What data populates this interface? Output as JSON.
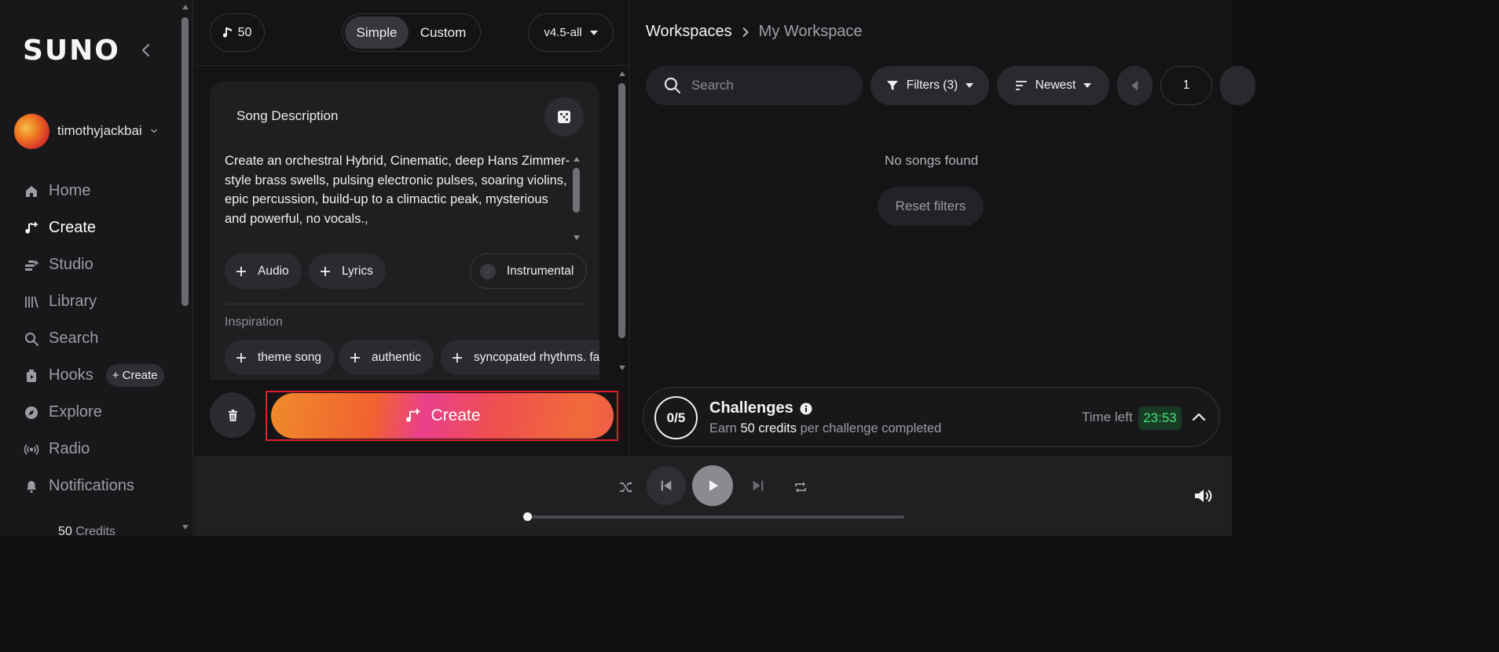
{
  "sidebar": {
    "logo": "SUNO",
    "username": "timothyjackbai",
    "nav": [
      {
        "label": "Home",
        "icon": "home-icon",
        "active": false
      },
      {
        "label": "Create",
        "icon": "music-note-plus-icon",
        "active": true
      },
      {
        "label": "Studio",
        "icon": "studio-icon",
        "active": false
      },
      {
        "label": "Library",
        "icon": "library-icon",
        "active": false
      },
      {
        "label": "Search",
        "icon": "search-icon",
        "active": false
      },
      {
        "label": "Hooks",
        "icon": "hooks-icon",
        "active": false
      },
      {
        "label": "Explore",
        "icon": "compass-icon",
        "active": false
      },
      {
        "label": "Radio",
        "icon": "radio-icon",
        "active": false
      },
      {
        "label": "Notifications",
        "icon": "bell-icon",
        "active": false
      }
    ],
    "hooks_create_label": "+ Create",
    "credits_value": "50",
    "credits_label": " Credits"
  },
  "create_panel": {
    "credits_count": "50",
    "mode_options": [
      "Simple",
      "Custom"
    ],
    "mode_selected": "Simple",
    "model_version": "v4.5-all",
    "card_title": "Song Description",
    "description": "Create an orchestral Hybrid, Cinematic, deep Hans Zimmer-style brass swells, pulsing electronic pulses, soaring violins, epic percussion, build-up to a climactic peak, mysterious and powerful, no vocals.,",
    "audio_label": "Audio",
    "lyrics_label": "Lyrics",
    "instrumental_label": "Instrumental",
    "inspiration_label": "Inspiration",
    "inspiration_tags": [
      "theme song",
      "authentic",
      "syncopated rhythms. fals"
    ],
    "create_label": "Create"
  },
  "workspace": {
    "breadcrumb_root": "Workspaces",
    "breadcrumb_current": "My Workspace",
    "search_placeholder": "Search",
    "filters_label": "Filters (3)",
    "sort_label": "Newest",
    "page_number": "1",
    "empty_message": "No songs found",
    "reset_label": "Reset filters"
  },
  "challenges": {
    "progress": "0/5",
    "title": "Challenges",
    "earn_prefix": "Earn ",
    "earn_amount": "50 credits",
    "earn_suffix": " per challenge completed",
    "time_left_label": "Time left",
    "timer": "23:53"
  },
  "player": {
    "progress_fraction": 0
  },
  "colors": {
    "accent_gradient_start": "#f08a2b",
    "accent_gradient_mid": "#ea3f8c",
    "timer_green": "#42e07a",
    "highlight_frame": "#e11d2a"
  }
}
